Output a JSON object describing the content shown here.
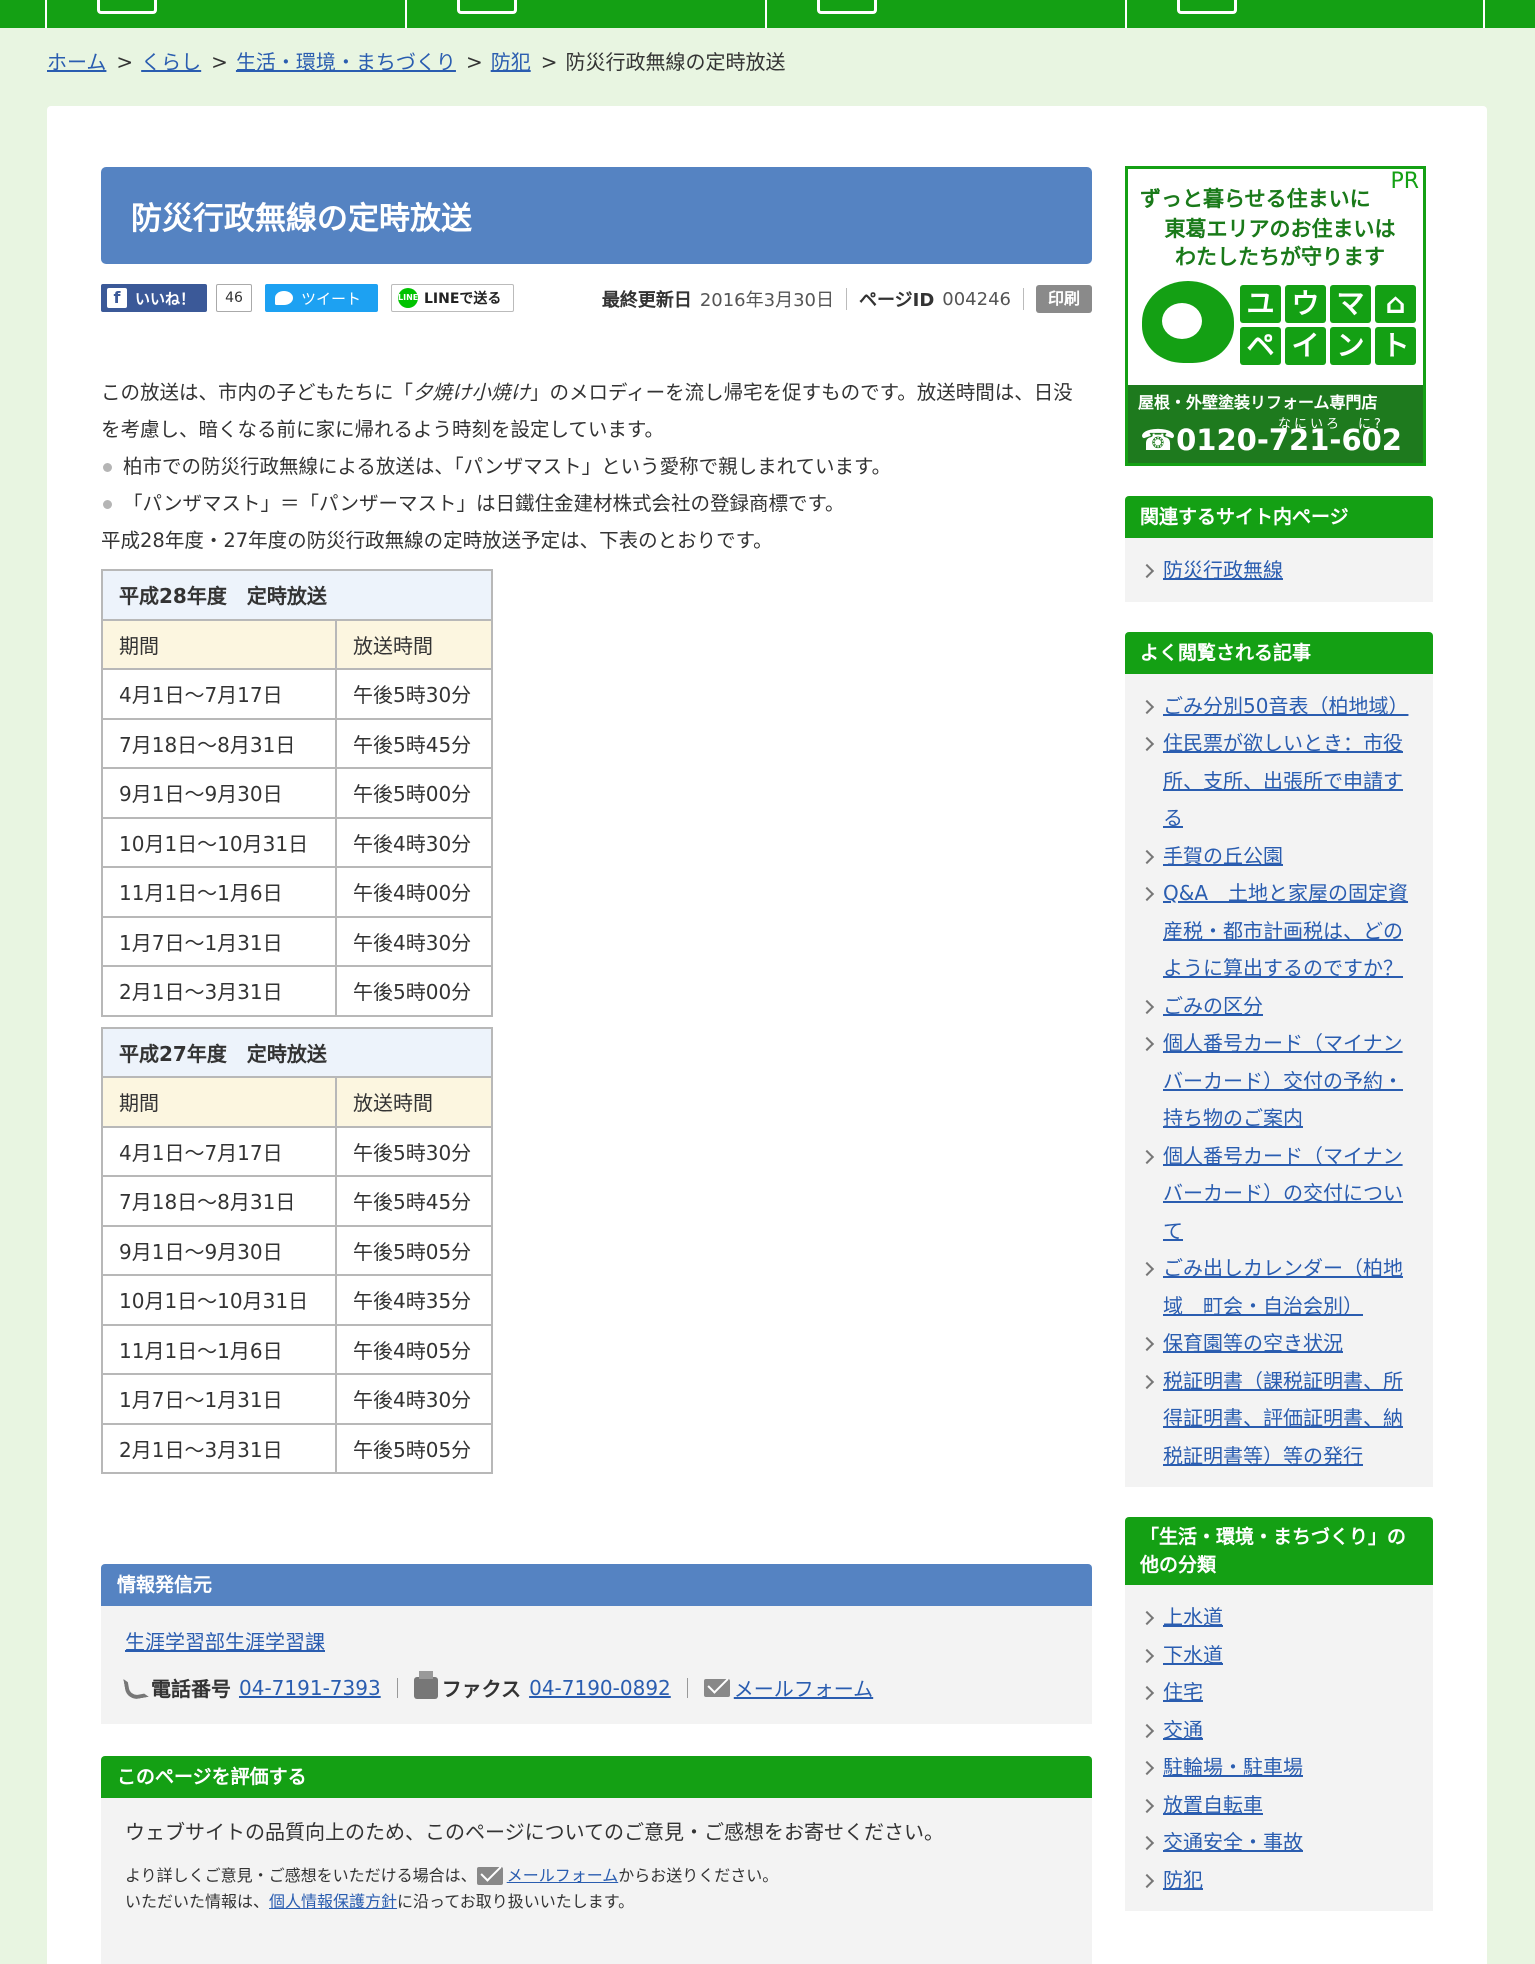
{
  "nav": {
    "cells": [
      "nav-1",
      "nav-2",
      "nav-3",
      "nav-4"
    ]
  },
  "breadcrumb": {
    "items": [
      "ホーム",
      "くらし",
      "生活・環境・まちづくり",
      "防犯"
    ],
    "current": "防災行政無線の定時放送",
    "separator": ">"
  },
  "page": {
    "title": "防災行政無線の定時放送",
    "fb_label": "いいね！",
    "fb_count": "46",
    "tweet_label": "ツイート",
    "line_label": "LINEで送る",
    "updated_label": "最終更新日",
    "updated_value": "2016年3月30日",
    "pageid_label": "ページID",
    "pageid_value": "004246",
    "print_label": "印刷"
  },
  "body": {
    "p1_a": "この放送は、市内の子どもたちに「",
    "p1_song": "夕焼け小焼け",
    "p1_b": "」のメロディーを流し帰宅を促すものです。放送時間は、日没を考慮し、暗くなる前に家に帰れるよう時刻を設定しています。",
    "bullet1": "柏市での防災行政無線による放送は、「パンザマスト」という愛称で親しまれています。",
    "bullet2": "「パンザマスト」＝「パンザーマスト」は日鐵住金建材株式会社の登録商標です。",
    "p2": "平成28年度・27年度の防災行政無線の定時放送予定は、下表のとおりです。"
  },
  "tables": [
    {
      "caption": "平成28年度　定時放送",
      "headers": [
        "期間",
        "放送時間"
      ],
      "rows": [
        [
          "4月1日～7月17日",
          "午後5時30分"
        ],
        [
          "7月18日～8月31日",
          "午後5時45分"
        ],
        [
          "9月1日～9月30日",
          "午後5時00分"
        ],
        [
          "10月1日～10月31日",
          "午後4時30分"
        ],
        [
          "11月1日～1月6日",
          "午後4時00分"
        ],
        [
          "1月7日～1月31日",
          "午後4時30分"
        ],
        [
          "2月1日～3月31日",
          "午後5時00分"
        ]
      ]
    },
    {
      "caption": "平成27年度　定時放送",
      "headers": [
        "期間",
        "放送時間"
      ],
      "rows": [
        [
          "4月1日～7月17日",
          "午後5時30分"
        ],
        [
          "7月18日～8月31日",
          "午後5時45分"
        ],
        [
          "9月1日～9月30日",
          "午後5時05分"
        ],
        [
          "10月1日～10月31日",
          "午後4時35分"
        ],
        [
          "11月1日～1月6日",
          "午後4時05分"
        ],
        [
          "1月7日～1月31日",
          "午後4時30分"
        ],
        [
          "2月1日～3月31日",
          "午後5時05分"
        ]
      ]
    }
  ],
  "info": {
    "heading": "情報発信元",
    "dept": "生涯学習部生涯学習課",
    "phone_label": "電話番号",
    "phone": "04-7191-7393",
    "fax_label": "ファクス",
    "fax": "04-7190-0892",
    "mail": "メールフォーム"
  },
  "eval": {
    "heading": "このページを評価する",
    "text": "ウェブサイトの品質向上のため、このページについてのご意見・ご感想をお寄せください。",
    "small_a": "より詳しくご意見・ご感想をいただける場合は、",
    "small_link": "メールフォーム",
    "small_b": "からお送りください。",
    "small2_a": "いただいた情報は、",
    "small2_link": "個人情報保護方針",
    "small2_b": "に沿ってお取り扱いいたします。"
  },
  "ad": {
    "pr": "PR",
    "line1": "ずっと暮らせる住まいに",
    "line2a": "東葛エリアのお住まいは",
    "line2b": "わたしたちが守ります",
    "brand_chars": [
      "ユ",
      "ウ",
      "マ",
      "⌂",
      "ペ",
      "イ",
      "ン",
      "ト"
    ],
    "strip": "屋根・外壁塗装リフォーム専門店",
    "ruby": "なにいろ　に?",
    "tel": "☎0120-721-602"
  },
  "sidebar": {
    "related_heading": "関連するサイト内ページ",
    "related": [
      "防災行政無線"
    ],
    "popular_heading": "よく閲覧される記事",
    "popular": [
      "ごみ分別50音表（柏地域）",
      "住民票が欲しいとき：市役所、支所、出張所で申請する",
      "手賀の丘公園",
      "Q&A　土地と家屋の固定資産税・都市計画税は、どのように算出するのですか？",
      "ごみの区分",
      "個人番号カード（マイナンバーカード）交付の予約・持ち物のご案内",
      "個人番号カード（マイナンバーカード）の交付について",
      "ごみ出しカレンダー（柏地域　町会・自治会別）",
      "保育園等の空き状況",
      "税証明書（課税証明書、所得証明書、評価証明書、納税証明書等）等の発行"
    ],
    "category_heading": "「生活・環境・まちづくり」の他の分類",
    "categories": [
      "上水道",
      "下水道",
      "住宅",
      "交通",
      "駐輪場・駐車場",
      "放置自転車",
      "交通安全・事故",
      "防犯"
    ]
  }
}
